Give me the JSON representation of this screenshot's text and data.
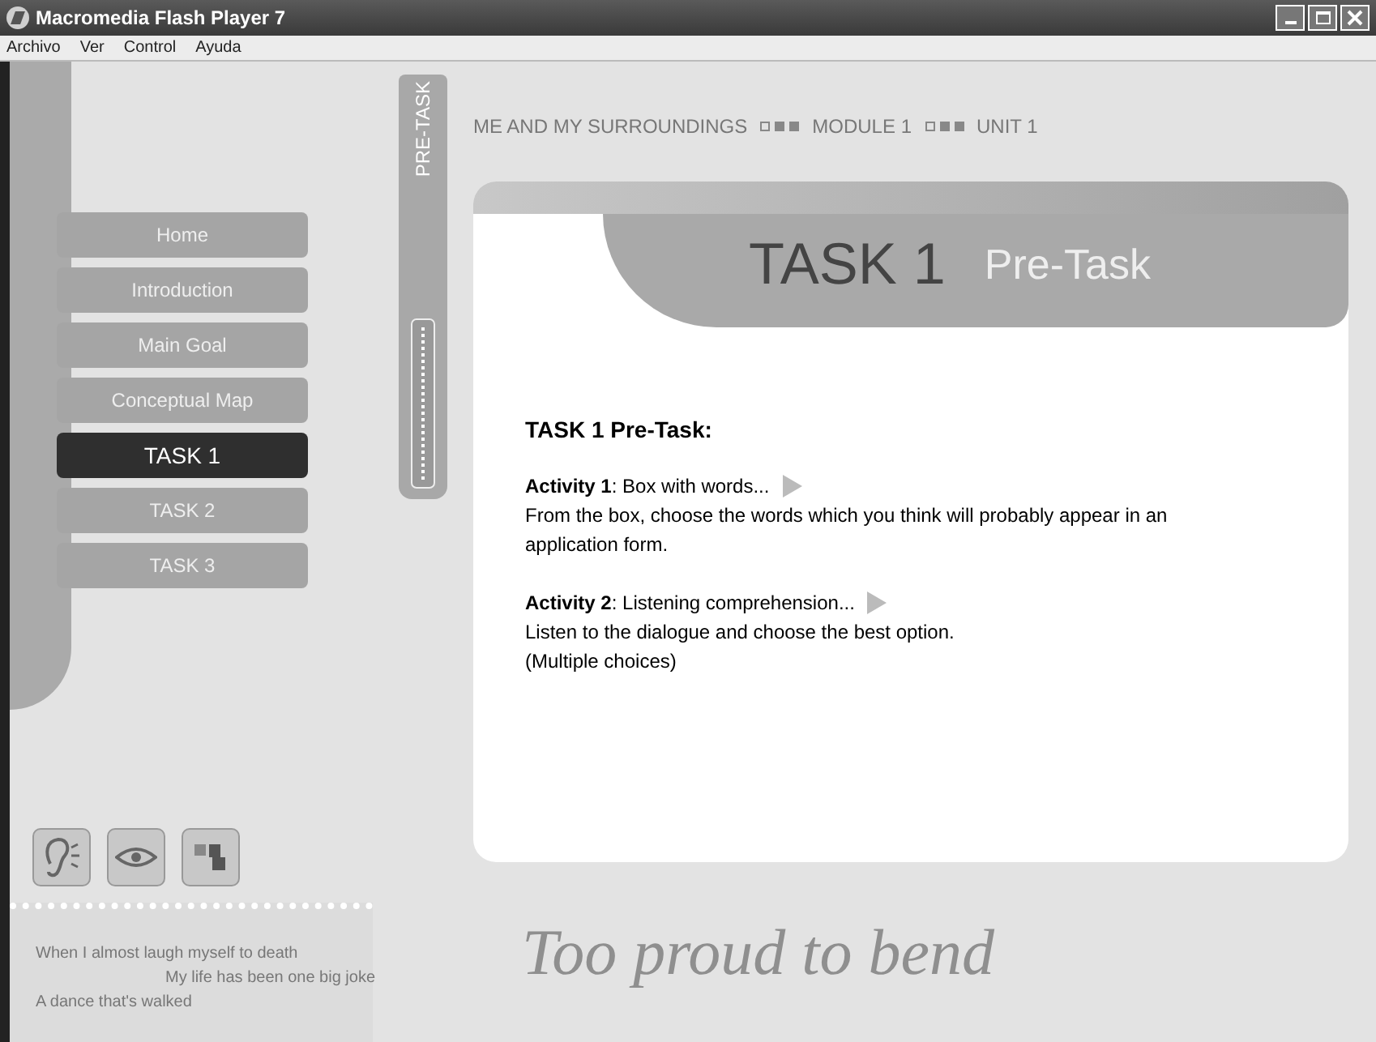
{
  "window": {
    "title": "Macromedia Flash Player 7"
  },
  "menu": [
    {
      "label": "Archivo"
    },
    {
      "label": "Ver"
    },
    {
      "label": "Control"
    },
    {
      "label": "Ayuda"
    }
  ],
  "nav": [
    {
      "label": "Home",
      "selected": false
    },
    {
      "label": "Introduction",
      "selected": false
    },
    {
      "label": "Main Goal",
      "selected": false
    },
    {
      "label": "Conceptual Map",
      "selected": false
    },
    {
      "label": "TASK 1",
      "selected": true
    },
    {
      "label": "TASK 2",
      "selected": false
    },
    {
      "label": "TASK 3",
      "selected": false
    }
  ],
  "side_tab": {
    "label": "PRE-TASK"
  },
  "breadcrumb": [
    "ME AND MY SURROUNDINGS",
    "MODULE 1",
    "UNIT 1"
  ],
  "card": {
    "title": "TASK 1",
    "subtitle": "Pre-Task",
    "heading": "TASK 1 Pre-Task:",
    "activities": [
      {
        "title": "**Activity 1**: Box with words...",
        "description": "From the box, choose the words which you think will probably appear in an application form."
      },
      {
        "title": "**Activity 2**: Listening comprehension...",
        "description": "Listen to the dialogue and choose the best option.\n(Multiple choices)"
      }
    ]
  },
  "lyrics": [
    "When I almost laugh myself to death",
    "My life has been one big joke",
    "A dance that's walked"
  ],
  "footer_title": "Too proud to bend"
}
